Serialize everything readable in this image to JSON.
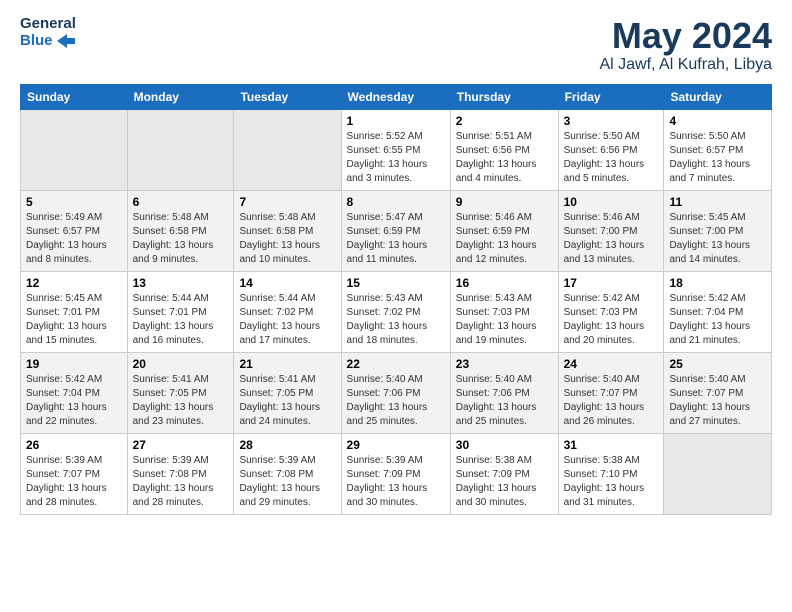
{
  "logo": {
    "name": "General",
    "name2": "Blue"
  },
  "title": "May 2024",
  "location": "Al Jawf, Al Kufrah, Libya",
  "weekdays": [
    "Sunday",
    "Monday",
    "Tuesday",
    "Wednesday",
    "Thursday",
    "Friday",
    "Saturday"
  ],
  "weeks": [
    [
      {
        "day": null,
        "sunrise": null,
        "sunset": null,
        "daylight": null
      },
      {
        "day": null,
        "sunrise": null,
        "sunset": null,
        "daylight": null
      },
      {
        "day": null,
        "sunrise": null,
        "sunset": null,
        "daylight": null
      },
      {
        "day": "1",
        "sunrise": "Sunrise: 5:52 AM",
        "sunset": "Sunset: 6:55 PM",
        "daylight": "Daylight: 13 hours and 3 minutes."
      },
      {
        "day": "2",
        "sunrise": "Sunrise: 5:51 AM",
        "sunset": "Sunset: 6:56 PM",
        "daylight": "Daylight: 13 hours and 4 minutes."
      },
      {
        "day": "3",
        "sunrise": "Sunrise: 5:50 AM",
        "sunset": "Sunset: 6:56 PM",
        "daylight": "Daylight: 13 hours and 5 minutes."
      },
      {
        "day": "4",
        "sunrise": "Sunrise: 5:50 AM",
        "sunset": "Sunset: 6:57 PM",
        "daylight": "Daylight: 13 hours and 7 minutes."
      }
    ],
    [
      {
        "day": "5",
        "sunrise": "Sunrise: 5:49 AM",
        "sunset": "Sunset: 6:57 PM",
        "daylight": "Daylight: 13 hours and 8 minutes."
      },
      {
        "day": "6",
        "sunrise": "Sunrise: 5:48 AM",
        "sunset": "Sunset: 6:58 PM",
        "daylight": "Daylight: 13 hours and 9 minutes."
      },
      {
        "day": "7",
        "sunrise": "Sunrise: 5:48 AM",
        "sunset": "Sunset: 6:58 PM",
        "daylight": "Daylight: 13 hours and 10 minutes."
      },
      {
        "day": "8",
        "sunrise": "Sunrise: 5:47 AM",
        "sunset": "Sunset: 6:59 PM",
        "daylight": "Daylight: 13 hours and 11 minutes."
      },
      {
        "day": "9",
        "sunrise": "Sunrise: 5:46 AM",
        "sunset": "Sunset: 6:59 PM",
        "daylight": "Daylight: 13 hours and 12 minutes."
      },
      {
        "day": "10",
        "sunrise": "Sunrise: 5:46 AM",
        "sunset": "Sunset: 7:00 PM",
        "daylight": "Daylight: 13 hours and 13 minutes."
      },
      {
        "day": "11",
        "sunrise": "Sunrise: 5:45 AM",
        "sunset": "Sunset: 7:00 PM",
        "daylight": "Daylight: 13 hours and 14 minutes."
      }
    ],
    [
      {
        "day": "12",
        "sunrise": "Sunrise: 5:45 AM",
        "sunset": "Sunset: 7:01 PM",
        "daylight": "Daylight: 13 hours and 15 minutes."
      },
      {
        "day": "13",
        "sunrise": "Sunrise: 5:44 AM",
        "sunset": "Sunset: 7:01 PM",
        "daylight": "Daylight: 13 hours and 16 minutes."
      },
      {
        "day": "14",
        "sunrise": "Sunrise: 5:44 AM",
        "sunset": "Sunset: 7:02 PM",
        "daylight": "Daylight: 13 hours and 17 minutes."
      },
      {
        "day": "15",
        "sunrise": "Sunrise: 5:43 AM",
        "sunset": "Sunset: 7:02 PM",
        "daylight": "Daylight: 13 hours and 18 minutes."
      },
      {
        "day": "16",
        "sunrise": "Sunrise: 5:43 AM",
        "sunset": "Sunset: 7:03 PM",
        "daylight": "Daylight: 13 hours and 19 minutes."
      },
      {
        "day": "17",
        "sunrise": "Sunrise: 5:42 AM",
        "sunset": "Sunset: 7:03 PM",
        "daylight": "Daylight: 13 hours and 20 minutes."
      },
      {
        "day": "18",
        "sunrise": "Sunrise: 5:42 AM",
        "sunset": "Sunset: 7:04 PM",
        "daylight": "Daylight: 13 hours and 21 minutes."
      }
    ],
    [
      {
        "day": "19",
        "sunrise": "Sunrise: 5:42 AM",
        "sunset": "Sunset: 7:04 PM",
        "daylight": "Daylight: 13 hours and 22 minutes."
      },
      {
        "day": "20",
        "sunrise": "Sunrise: 5:41 AM",
        "sunset": "Sunset: 7:05 PM",
        "daylight": "Daylight: 13 hours and 23 minutes."
      },
      {
        "day": "21",
        "sunrise": "Sunrise: 5:41 AM",
        "sunset": "Sunset: 7:05 PM",
        "daylight": "Daylight: 13 hours and 24 minutes."
      },
      {
        "day": "22",
        "sunrise": "Sunrise: 5:40 AM",
        "sunset": "Sunset: 7:06 PM",
        "daylight": "Daylight: 13 hours and 25 minutes."
      },
      {
        "day": "23",
        "sunrise": "Sunrise: 5:40 AM",
        "sunset": "Sunset: 7:06 PM",
        "daylight": "Daylight: 13 hours and 25 minutes."
      },
      {
        "day": "24",
        "sunrise": "Sunrise: 5:40 AM",
        "sunset": "Sunset: 7:07 PM",
        "daylight": "Daylight: 13 hours and 26 minutes."
      },
      {
        "day": "25",
        "sunrise": "Sunrise: 5:40 AM",
        "sunset": "Sunset: 7:07 PM",
        "daylight": "Daylight: 13 hours and 27 minutes."
      }
    ],
    [
      {
        "day": "26",
        "sunrise": "Sunrise: 5:39 AM",
        "sunset": "Sunset: 7:07 PM",
        "daylight": "Daylight: 13 hours and 28 minutes."
      },
      {
        "day": "27",
        "sunrise": "Sunrise: 5:39 AM",
        "sunset": "Sunset: 7:08 PM",
        "daylight": "Daylight: 13 hours and 28 minutes."
      },
      {
        "day": "28",
        "sunrise": "Sunrise: 5:39 AM",
        "sunset": "Sunset: 7:08 PM",
        "daylight": "Daylight: 13 hours and 29 minutes."
      },
      {
        "day": "29",
        "sunrise": "Sunrise: 5:39 AM",
        "sunset": "Sunset: 7:09 PM",
        "daylight": "Daylight: 13 hours and 30 minutes."
      },
      {
        "day": "30",
        "sunrise": "Sunrise: 5:38 AM",
        "sunset": "Sunset: 7:09 PM",
        "daylight": "Daylight: 13 hours and 30 minutes."
      },
      {
        "day": "31",
        "sunrise": "Sunrise: 5:38 AM",
        "sunset": "Sunset: 7:10 PM",
        "daylight": "Daylight: 13 hours and 31 minutes."
      },
      {
        "day": null,
        "sunrise": null,
        "sunset": null,
        "daylight": null
      }
    ]
  ]
}
